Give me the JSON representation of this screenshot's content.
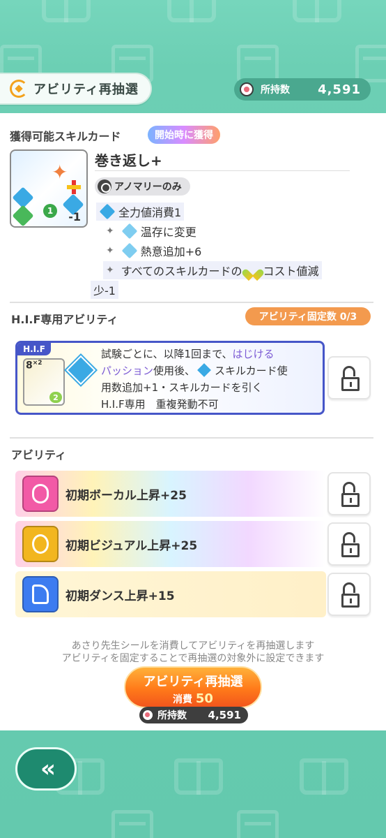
{
  "header": {
    "reroll_tab_label": "アビリティ再抽選",
    "owned_label": "所持数",
    "owned_value": "4,591"
  },
  "skill_section": {
    "title": "獲得可能スキルカード",
    "start_badge": "開始時に獲得",
    "card": {
      "name": "巻き返し+",
      "cost_number": "1",
      "cost_modifier": "-1",
      "restriction_badge": "アノマリーのみ",
      "effects": [
        "全力値消費1",
        "温存に変更",
        "熱意追加+6",
        "すべてのスキルカードの",
        "コスト値減",
        "少-1"
      ]
    }
  },
  "hif_section": {
    "title": "H.I.F専用アビリティ",
    "fixed_count_label": "アビリティ固定数 0/3",
    "card_tag": "H.I.F",
    "card_level": "8",
    "card_level_sup": "×2",
    "card_cost": "2",
    "text_line1_a": "試験ごとに、以降1回まで、",
    "text_line1_b": "はじける",
    "text_line2_a": "パッション",
    "text_line2_b": "使用後、",
    "text_line2_c": "スキルカード使",
    "text_line3": "用数追加+1・スキルカードを引く",
    "text_line4": "H.I.F専用　重複発動不可"
  },
  "ability_section": {
    "title": "アビリティ",
    "items": [
      {
        "label": "初期ボーカル上昇+25",
        "icon": "microphone-icon"
      },
      {
        "label": "初期ビジュアル上昇+25",
        "icon": "visual-face-icon"
      },
      {
        "label": "初期ダンス上昇+15",
        "icon": "dance-shoe-icon"
      }
    ]
  },
  "footer": {
    "help_line1": "あさり先生シールを消費してアビリティを再抽選します",
    "help_line2": "アビリティを固定することで再抽選の対象外に設定できます",
    "reroll_button_label": "アビリティ再抽選",
    "cost_label": "消費",
    "cost_value": "50",
    "owned_label": "所持数",
    "owned_value": "4,591"
  },
  "nav": {
    "back_icon": "double-chevron-left-icon"
  },
  "colors": {
    "background": "#6ecfb6",
    "accent_orange": "#ff7a1a",
    "hif_border": "#4656c8",
    "fixed_badge": "#f39a4e"
  }
}
